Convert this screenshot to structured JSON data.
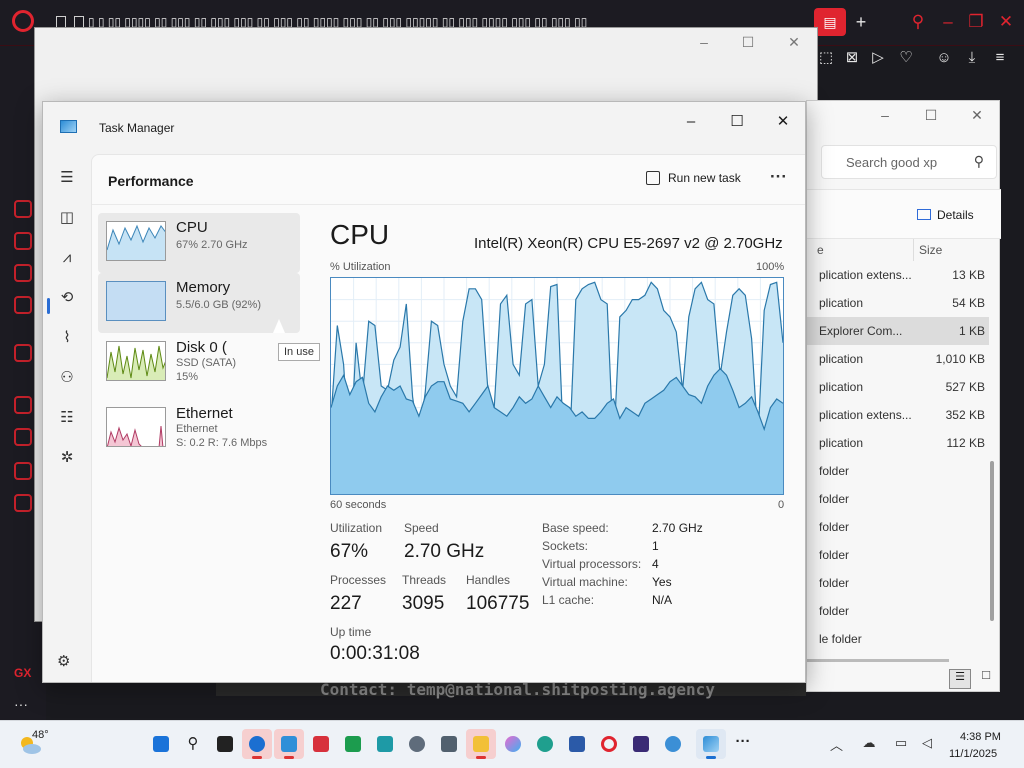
{
  "opera": {
    "tabs_text": "▯ ▯ ▯▯ ▯▯▯▯ ▯▯ ▯▯▯ ▯▯ ▯▯▯ ▯▯▯ ▯▯ ▯▯▯ ▯▯ ▯▯▯▯ ▯▯▯ ▯▯ ▯▯▯ ▯▯▯▯▯ ▯▯ ▯▯▯ ▯▯▯▯ ▯▯▯ ▯▯ ▯▯▯ ▯▯",
    "gx_label": "GX",
    "more_label": "···"
  },
  "explorer": {
    "search_placeholder": "Search good xp",
    "details_label": "Details",
    "col_type": "e",
    "col_size": "Size",
    "rows": [
      {
        "type": "plication extens...",
        "size": "13 KB"
      },
      {
        "type": "plication",
        "size": "54 KB"
      },
      {
        "type": "Explorer Com...",
        "size": "1 KB"
      },
      {
        "type": "plication",
        "size": "1,010 KB"
      },
      {
        "type": "plication",
        "size": "527 KB"
      },
      {
        "type": "plication extens...",
        "size": "352 KB"
      },
      {
        "type": "plication",
        "size": "112 KB"
      },
      {
        "type": "folder",
        "size": ""
      },
      {
        "type": "folder",
        "size": ""
      },
      {
        "type": "folder",
        "size": ""
      },
      {
        "type": "folder",
        "size": ""
      },
      {
        "type": "folder",
        "size": ""
      },
      {
        "type": "folder",
        "size": ""
      },
      {
        "type": "le folder",
        "size": ""
      }
    ]
  },
  "terminal": {
    "text": "Contact: temp@national.shitposting.agency"
  },
  "taskmanager": {
    "title": "Task Manager",
    "page_title": "Performance",
    "run_new_task": "Run new task",
    "more": "···",
    "sidebar": [
      {
        "name": "CPU",
        "sub1": "67% 2.70 GHz",
        "sub2": ""
      },
      {
        "name": "Memory",
        "sub1": "5.5/6.0 GB (92%)",
        "sub2": ""
      },
      {
        "name": "Disk 0 (",
        "sub1": "SSD (SATA)",
        "sub2": "15%"
      },
      {
        "name": "Ethernet",
        "sub1": "Ethernet",
        "sub2": "S: 0.2 R: 7.6 Mbps"
      }
    ],
    "tooltip": "In use",
    "cpu": {
      "heading": "CPU",
      "model": "Intel(R) Xeon(R) CPU E5-2697 v2 @ 2.70GHz",
      "util_label": "% Utilization",
      "util_max": "100%",
      "time_left": "60 seconds",
      "time_right": "0",
      "stats": {
        "utilization_label": "Utilization",
        "utilization": "67%",
        "speed_label": "Speed",
        "speed": "2.70 GHz",
        "processes_label": "Processes",
        "processes": "227",
        "threads_label": "Threads",
        "threads": "3095",
        "handles_label": "Handles",
        "handles": "106775",
        "uptime_label": "Up time",
        "uptime": "0:00:31:08"
      },
      "specs": [
        {
          "k": "Base speed:",
          "v": "2.70 GHz"
        },
        {
          "k": "Sockets:",
          "v": "1"
        },
        {
          "k": "Virtual processors:",
          "v": "4"
        },
        {
          "k": "Virtual machine:",
          "v": "Yes"
        },
        {
          "k": "L1 cache:",
          "v": "N/A"
        }
      ],
      "graph_total": [
        35,
        78,
        60,
        15,
        70,
        45,
        80,
        78,
        50,
        48,
        62,
        68,
        88,
        45,
        25,
        47,
        80,
        78,
        60,
        50,
        45,
        80,
        95,
        95,
        90,
        48,
        40,
        88,
        92,
        60,
        55,
        88,
        90,
        50,
        60,
        96,
        97,
        25,
        22,
        90,
        95,
        97,
        98,
        90,
        88,
        20,
        82,
        85,
        90,
        90,
        92,
        98,
        95,
        85,
        82,
        75,
        48,
        82,
        95,
        98,
        90,
        88,
        55,
        75,
        92,
        95,
        92,
        72,
        25,
        85,
        97,
        98,
        70
      ],
      "graph_kernel": [
        40,
        50,
        55,
        46,
        52,
        54,
        42,
        38,
        45,
        50,
        48,
        50,
        44,
        43,
        36,
        45,
        50,
        52,
        52,
        44,
        43,
        42,
        38,
        42,
        46,
        50,
        40,
        38,
        36,
        40,
        45,
        42,
        44,
        50,
        45,
        40,
        45,
        42,
        40,
        36,
        38,
        35,
        35,
        38,
        42,
        44,
        35,
        40,
        38,
        36,
        42,
        44,
        46,
        48,
        52,
        54,
        50,
        46,
        45,
        42,
        50,
        55,
        58,
        55,
        48,
        40,
        42,
        45,
        38,
        30,
        40,
        44,
        42
      ]
    }
  },
  "taskbar": {
    "temp": "48°",
    "time": "4:38 PM",
    "date": "11/1/2025"
  }
}
